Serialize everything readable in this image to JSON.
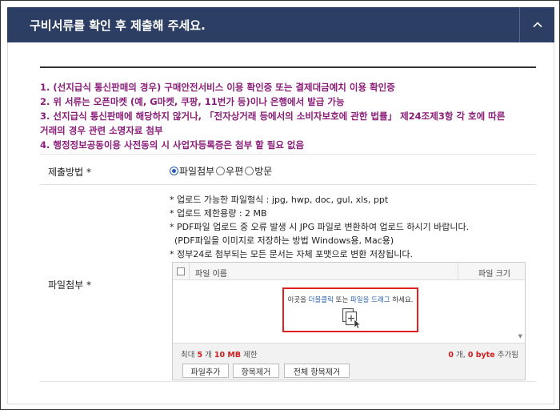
{
  "header": {
    "title": "구비서류를 확인 후 제출해 주세요.",
    "collapse_icon": "chevron-up-icon"
  },
  "notice": {
    "lines": [
      "1. (선지급식 통신판매의 경우) 구매안전서비스 이용 확인증 또는 결제대금예치 이용 확인증",
      "2. 위 서류는 오픈마켓 (예, G마켓, 쿠팡, 11번가 등)이나 은행에서 발급 가능",
      "3. 선지급식 통신판매에 해당하지 않거나, 「전자상거래 등에서의 소비자보호에 관한 법률」 제24조제3항 각 호에 따른",
      "거래의 경우 관련 소명자료 첨부",
      "4. 행정정보공동이용 사전동의 시 사업자등록증은 첨부 할 필요 없음"
    ],
    "color": "#8b1e7a"
  },
  "submit_method": {
    "label": "제출방법 *",
    "options": [
      "파일첨부",
      "우편",
      "방문"
    ],
    "selected": "파일첨부"
  },
  "attachment": {
    "label": "파일첨부 *",
    "info": [
      "* 업로드 가능한 파일형식 : jpg, hwp, doc, gul, xls, ppt",
      "* 업로드 제한용량 : 2 MB",
      "* PDF파일 업로드 중 오류 발생 시 JPG 파일로 변환하여 업로드 하시기 바랍니다.",
      "(PDF파일을 이미지로 저장하는 방법  Windows용, Mac용)",
      "* 정부24로 첨부되는 모든 문서는 자체 포맷으로 변환 저장됩니다."
    ],
    "table": {
      "col_name": "파일 이름",
      "col_size": "파일 크기"
    },
    "drop": {
      "prefix": "이곳을 ",
      "link1": "더블클릭",
      "middle": " 또는 ",
      "link2": "파일을 드래그",
      "suffix": " 하세요.",
      "icon": "add-file-icon"
    },
    "limits": {
      "prefix": "최대 ",
      "max_count": "5",
      "mid": " 개 ",
      "max_size": "10 MB",
      "suffix": " 제한",
      "added_count": "0",
      "count_unit": " 개, ",
      "added_size": "0 byte",
      "added_suffix": " 추가됨"
    },
    "buttons": {
      "add": "파일추가",
      "remove": "항목제거",
      "remove_all": "전체 항목제거"
    }
  }
}
